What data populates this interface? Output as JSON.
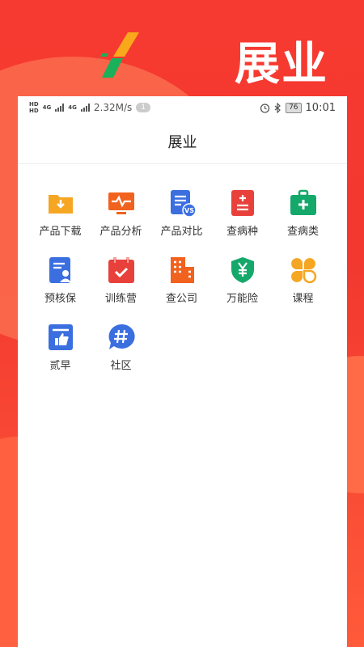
{
  "brand": {
    "hero_title": "展业",
    "logo_colors": [
      "#f9a81b",
      "#1bb05a"
    ]
  },
  "status_bar": {
    "network_speed": "2.32M/s",
    "notification_count": "1",
    "battery": "76",
    "time": "10:01",
    "hd1": "HD",
    "hd2": "HD",
    "net1": "4G",
    "net2": "4G"
  },
  "nav": {
    "title": "展业"
  },
  "menu": [
    {
      "label": "产品下载",
      "icon": "folder-download-icon",
      "color": "#f5a623"
    },
    {
      "label": "产品分析",
      "icon": "monitor-pulse-icon",
      "color": "#f1621e"
    },
    {
      "label": "产品对比",
      "icon": "document-vs-icon",
      "color": "#3b6fe0"
    },
    {
      "label": "查病种",
      "icon": "medical-record-icon",
      "color": "#e8413b"
    },
    {
      "label": "查病类",
      "icon": "first-aid-kit-icon",
      "color": "#14a86a"
    },
    {
      "label": "预核保",
      "icon": "document-person-icon",
      "color": "#3b6fe0"
    },
    {
      "label": "训练营",
      "icon": "calendar-check-icon",
      "color": "#e8413b"
    },
    {
      "label": "查公司",
      "icon": "building-icon",
      "color": "#f1621e"
    },
    {
      "label": "万能险",
      "icon": "shield-yen-icon",
      "color": "#14a86a"
    },
    {
      "label": "课程",
      "icon": "clover-icon",
      "color": "#f5a623"
    },
    {
      "label": "贰早",
      "icon": "document-thumbsup-icon",
      "color": "#3b6fe0"
    },
    {
      "label": "社区",
      "icon": "chat-hashtag-icon",
      "color": "#3b6fe0"
    }
  ]
}
